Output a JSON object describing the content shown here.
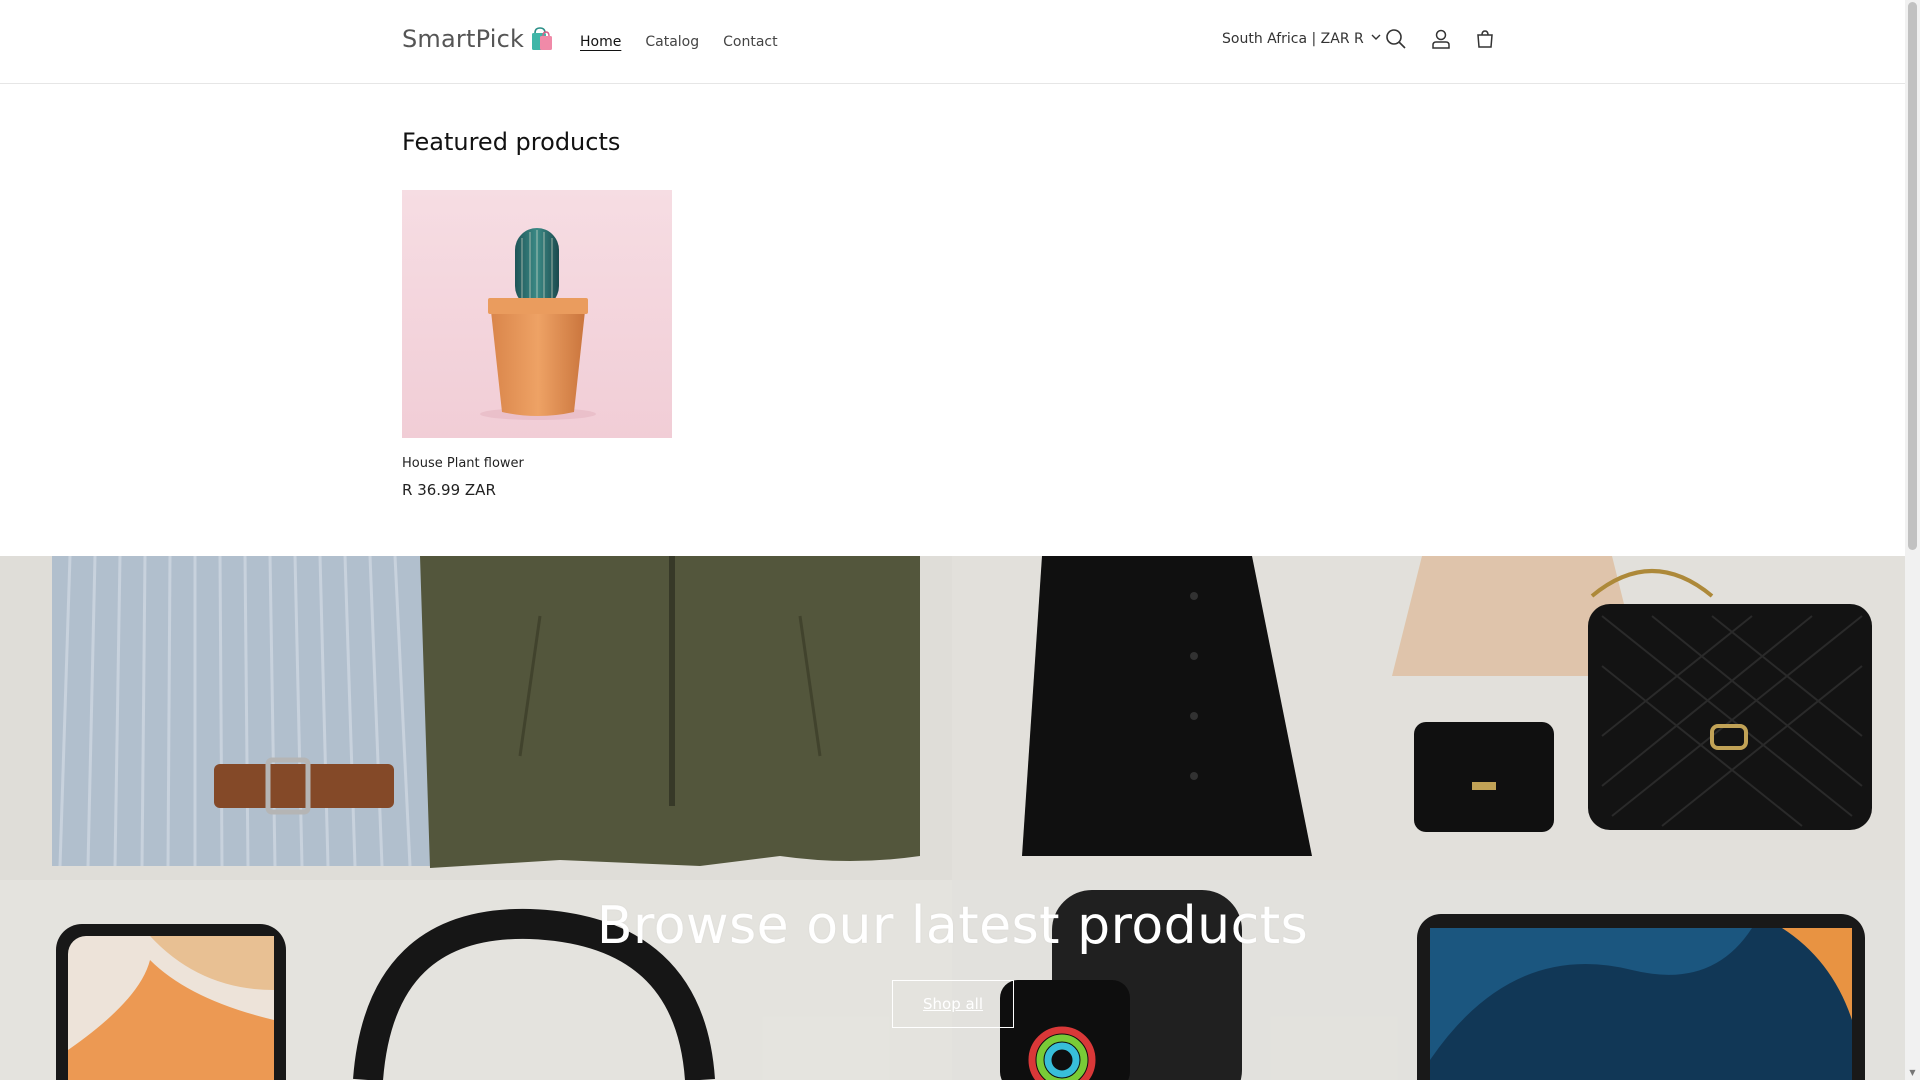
{
  "header": {
    "logo_text": "SmartPick",
    "nav": [
      {
        "label": "Home",
        "active": true
      },
      {
        "label": "Catalog",
        "active": false
      },
      {
        "label": "Contact",
        "active": false
      }
    ],
    "country_selector": "South Africa | ZAR R",
    "icons": [
      "search-icon",
      "account-icon",
      "cart-icon"
    ]
  },
  "featured": {
    "title": "Featured products",
    "products": [
      {
        "name": "House Plant flower",
        "price": "R 36.99 ZAR"
      }
    ]
  },
  "banner": {
    "heading": "Browse our latest products",
    "button_label": "Shop all"
  },
  "colors": {
    "text": "#121212",
    "border": "#e6e6e6",
    "card_bg": "#f3d4dc",
    "pot": "#e39a5c",
    "cactus": "#2f6f6a"
  }
}
